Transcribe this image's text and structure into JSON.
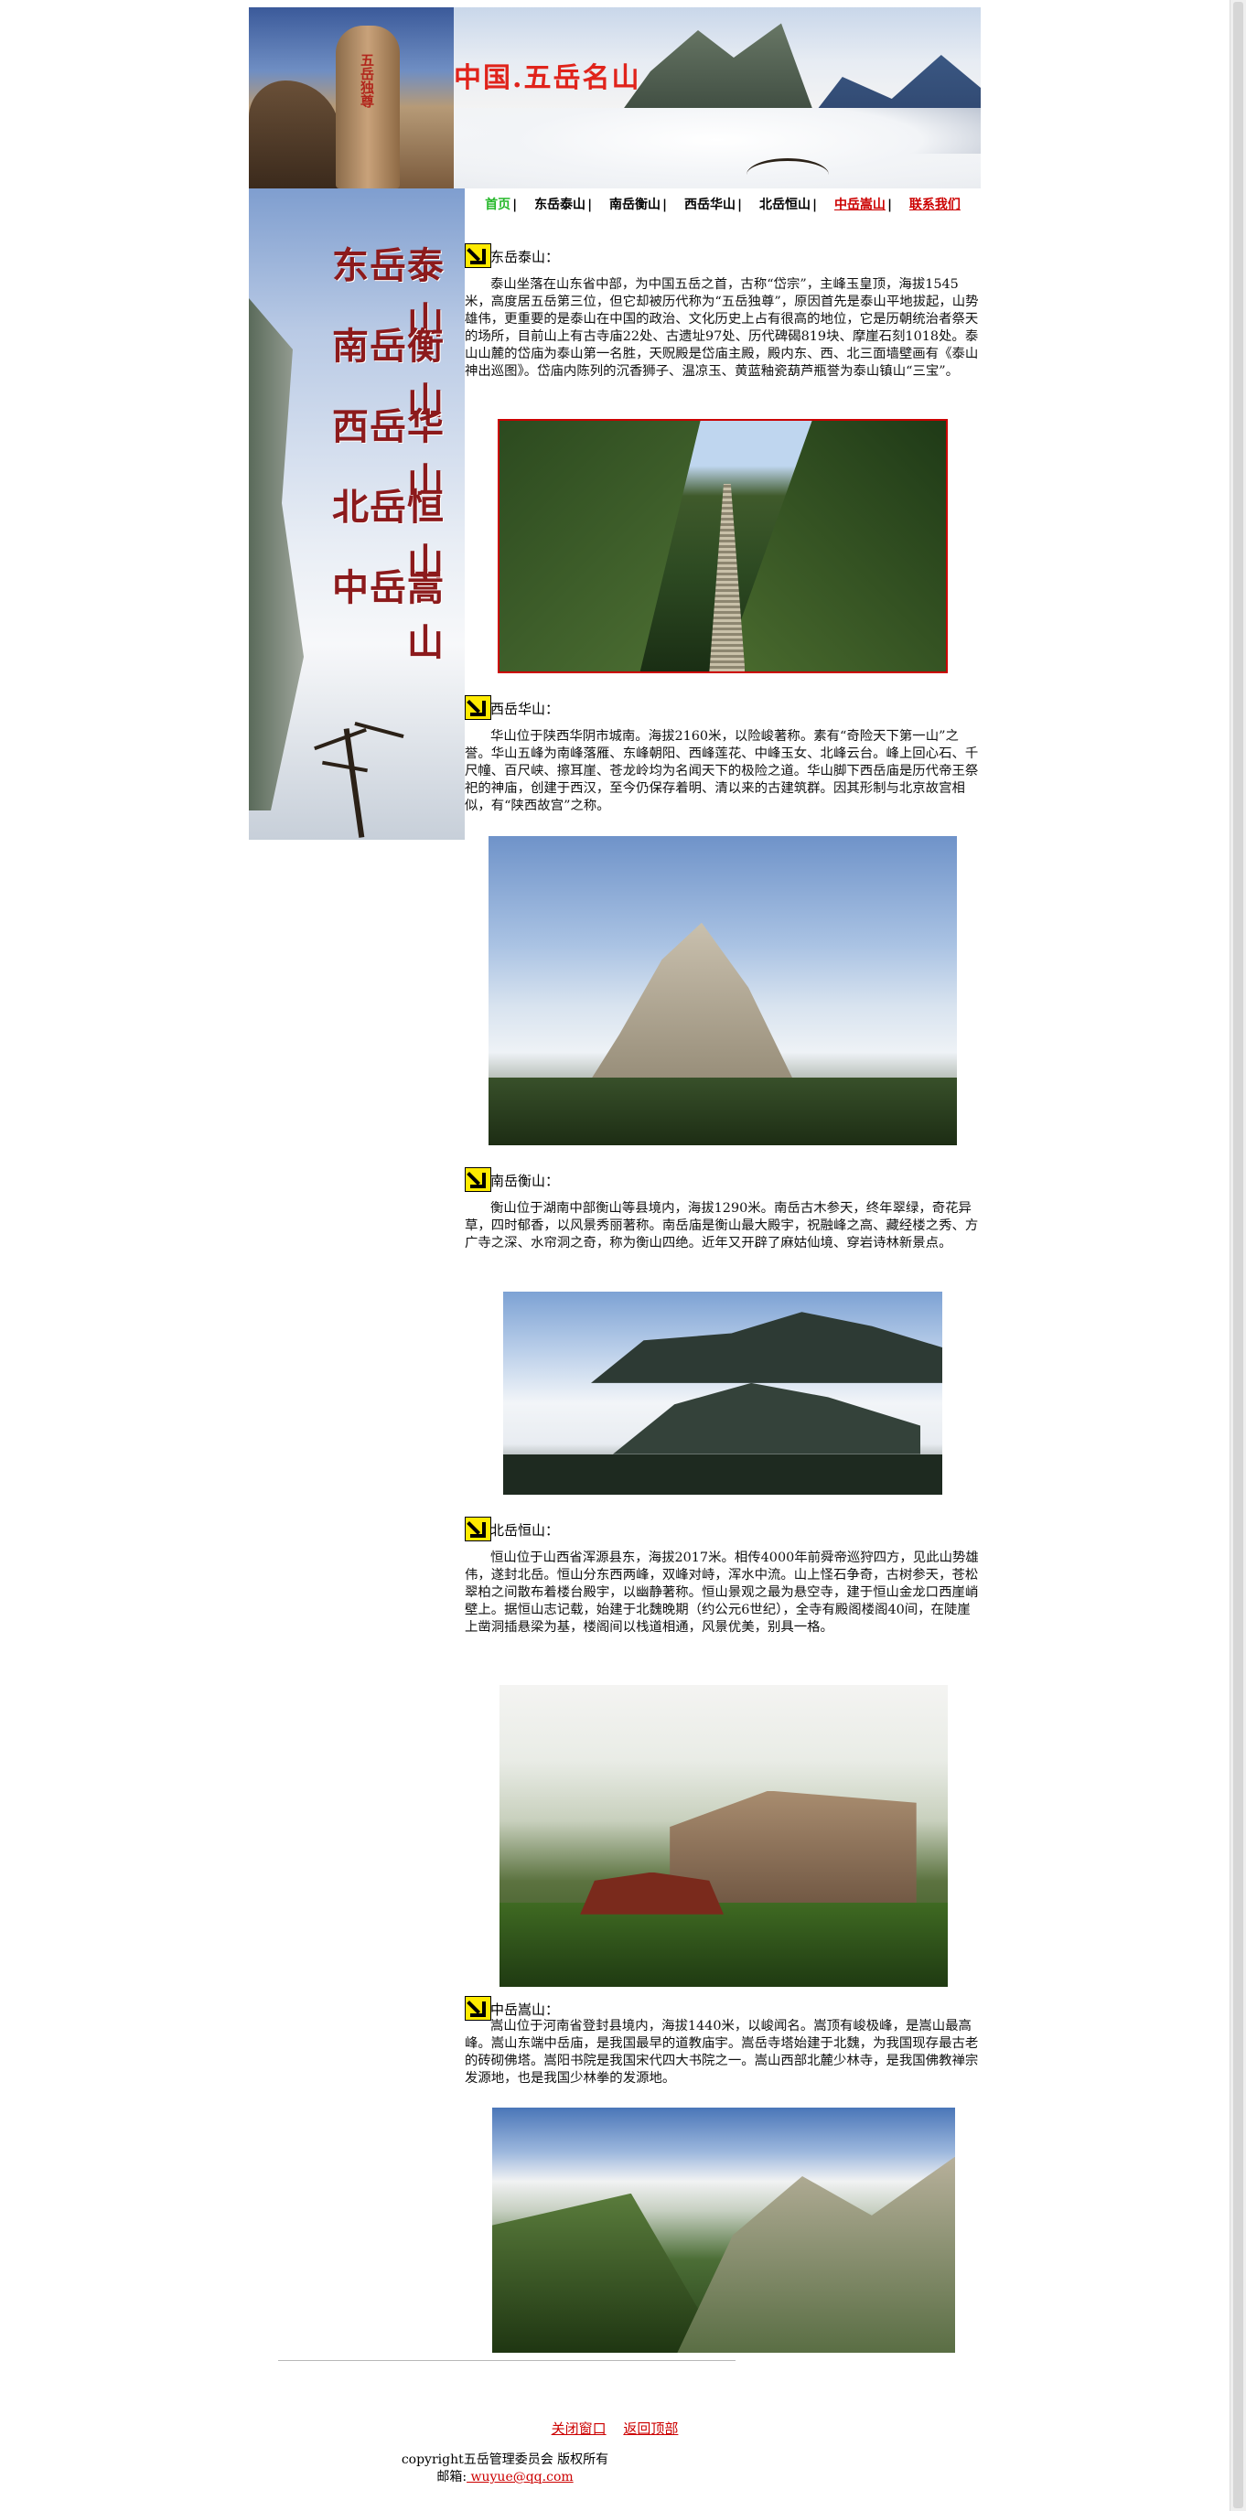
{
  "header": {
    "title": "中国.五岳名山",
    "logo_carving": "五岳独尊"
  },
  "sidebar": {
    "items": [
      {
        "label": "东岳泰山"
      },
      {
        "label": "南岳衡山"
      },
      {
        "label": "西岳华山"
      },
      {
        "label": "北岳恒山"
      },
      {
        "label": "中岳嵩山"
      }
    ]
  },
  "nav": {
    "items": [
      {
        "label": "首页"
      },
      {
        "label": "东岳泰山"
      },
      {
        "label": "南岳衡山"
      },
      {
        "label": "西岳华山"
      },
      {
        "label": "北岳恒山"
      },
      {
        "label": "中岳嵩山"
      },
      {
        "label": "联系我们"
      }
    ],
    "separator": "|"
  },
  "sections": {
    "tai": {
      "title": "东岳泰山：",
      "text": "泰山坐落在山东省中部，为中国五岳之首，古称“岱宗”，主峰玉皇顶，海拔1545米，高度居五岳第三位，但它却被历代称为“五岳独尊”，原因首先是泰山平地拔起，山势雄伟，更重要的是泰山在中国的政治、文化历史上占有很高的地位，它是历朝统治者祭天的场所，目前山上有古寺庙22处、古遗址97处、历代碑碣819块、摩崖石刻1018处。泰山山麓的岱庙为泰山第一名胜，天贶殿是岱庙主殿，殿内东、西、北三面墙壁画有《泰山神出巡图》。岱庙内陈列的沉香狮子、温凉玉、黄蓝釉瓷葫芦瓶誉为泰山镇山“三宝”。"
    },
    "hua": {
      "title": "西岳华山：",
      "text": "华山位于陕西华阴市城南。海拔2160米，以险峻著称。素有“奇险天下第一山”之誉。华山五峰为南峰落雁、东峰朝阳、西峰莲花、中峰玉女、北峰云台。峰上回心石、千尺幢、百尺峡、擦耳崖、苍龙岭均为名闻天下的极险之道。华山脚下西岳庙是历代帝王祭祀的神庙，创建于西汉，至今仍保存着明、清以来的古建筑群。因其形制与北京故宫相似，有“陕西故宫”之称。"
    },
    "heng": {
      "title": "南岳衡山：",
      "text": "衡山位于湖南中部衡山等县境内，海拔1290米。南岳古木参天，终年翠绿，奇花异草，四时郁香，以风景秀丽著称。南岳庙是衡山最大殿宇，祝融峰之高、藏经楼之秀、方广寺之深、水帘洞之奇，称为衡山四绝。近年又开辟了麻姑仙境、穿岩诗林新景点。"
    },
    "hengN": {
      "title": "北岳恒山：",
      "text": "恒山位于山西省浑源县东，海拔2017米。相传4000年前舜帝巡狩四方，见此山势雄伟，遂封北岳。恒山分东西两峰，双峰对峙，浑水中流。山上怪石争奇，古树参天，苍松翠柏之间散布着楼台殿宇，以幽静著称。恒山景观之最为悬空寺，建于恒山金龙口西崖峭壁上。据恒山志记载，始建于北魏晚期（约公元6世纪），全寺有殿阁楼阁40间，在陡崖上凿洞插悬梁为基，楼阁间以栈道相通，风景优美，别具一格。"
    },
    "song": {
      "title": "中岳嵩山：",
      "text": "嵩山位于河南省登封县境内，海拔1440米，以峻闻名。嵩顶有峻极峰，是嵩山最高峰。嵩山东端中岳庙，是我国最早的道教庙宇。嵩岳寺塔始建于北魏，为我国现存最古老的砖砌佛塔。嵩阳书院是我国宋代四大书院之一。嵩山西部北麓少林寺，是我国佛教禅宗发源地，也是我国少林拳的发源地。"
    }
  },
  "footer": {
    "close_label": "关闭窗口",
    "top_label": "返回顶部",
    "copyright": "copyright五岳管理委员会 版权所有",
    "email_prefix": "邮箱:",
    "email": " wuyue@qq.com"
  }
}
